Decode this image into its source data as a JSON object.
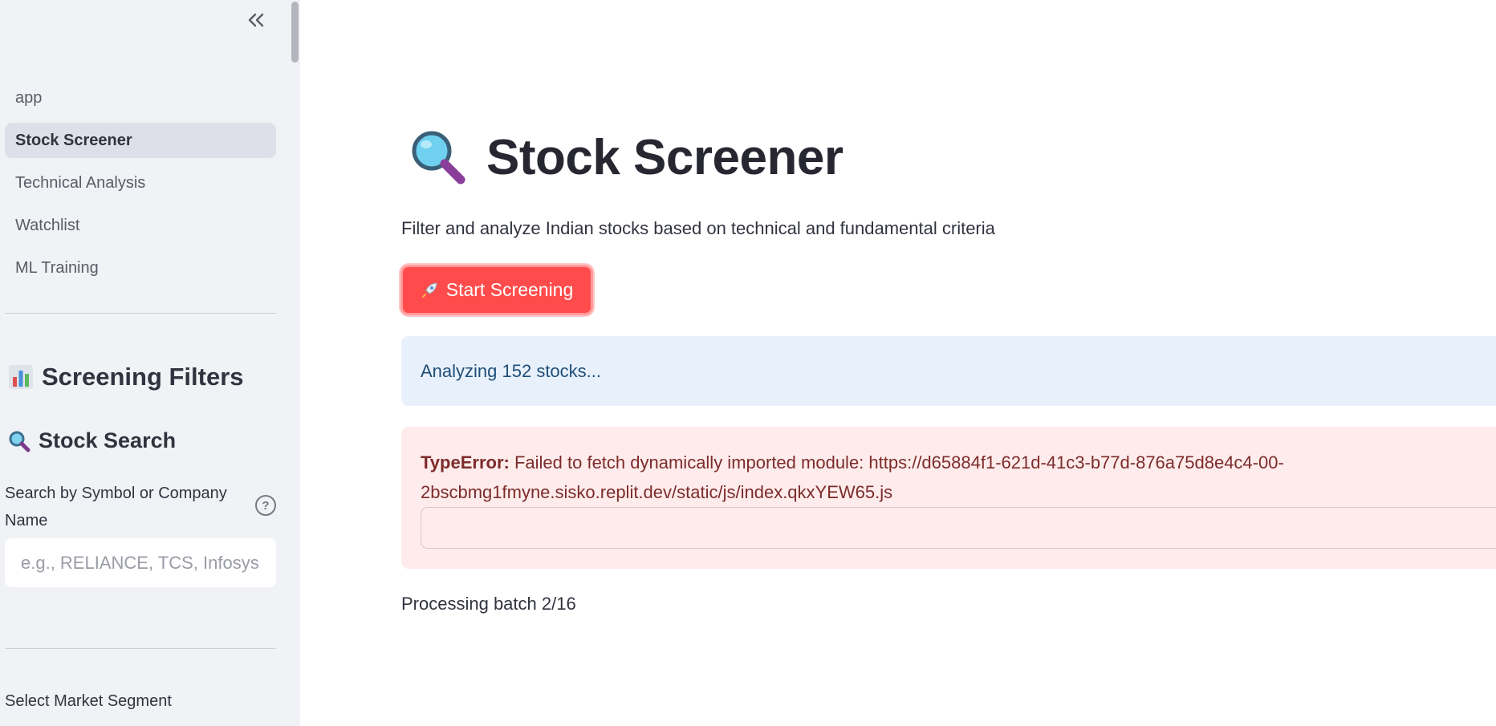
{
  "sidebar": {
    "nav_items": [
      {
        "label": "app",
        "active": false
      },
      {
        "label": "Stock Screener",
        "active": true
      },
      {
        "label": "Technical Analysis",
        "active": false
      },
      {
        "label": "Watchlist",
        "active": false
      },
      {
        "label": "ML Training",
        "active": false
      }
    ],
    "filters_title": "Screening Filters",
    "filters_icon": "bar-chart-icon",
    "search_section_title": "Stock Search",
    "search_section_icon": "magnifier-icon",
    "search_label": "Search by Symbol or Company Name",
    "search_placeholder": "e.g., RELIANCE, TCS, Infosys",
    "search_value": "",
    "segment_label": "Select Market Segment"
  },
  "main": {
    "title": "Stock Screener",
    "title_icon": "magnifier-icon",
    "subtitle": "Filter and analyze Indian stocks based on technical and fundamental criteria",
    "start_button_label": "Start Screening",
    "start_button_icon": "rocket-icon",
    "info_message": "Analyzing 152 stocks...",
    "error_type": "TypeError:",
    "error_message": "Failed to fetch dynamically imported module: https://d65884f1-621d-41c3-b77d-876a75d8e4c4-00-2bscbmg1fmyne.sisko.replit.dev/static/js/index.qkxYEW65.js",
    "batch_status": "Processing batch 2/16"
  },
  "colors": {
    "sidebar_bg": "#f0f2f6",
    "primary_button": "#ff4b4b",
    "info_bg": "#e8f1fb",
    "error_bg": "#fdeceb"
  }
}
